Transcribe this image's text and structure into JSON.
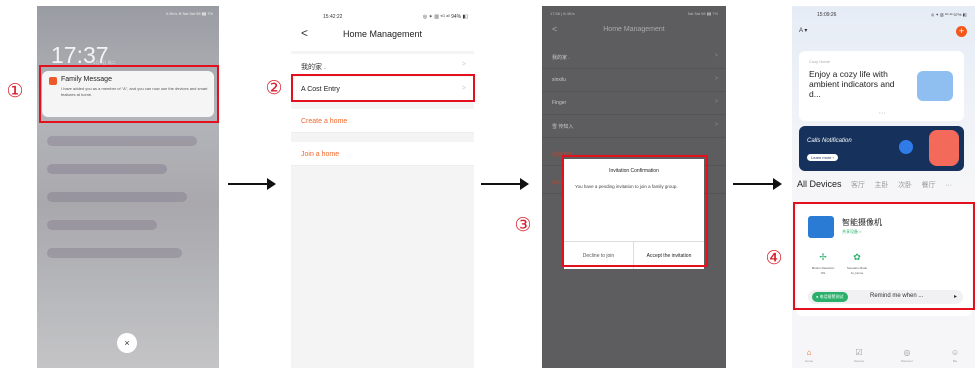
{
  "steps": [
    "①",
    "②",
    "③",
    "④"
  ],
  "screen1": {
    "status": "0.0K/s ≋ 5at 5at 98 ▮▮ 7%",
    "clock": "17:37",
    "clock_date": "4月 9日 周二",
    "notification": {
      "title": "Family Message",
      "body": "I have added you as a member of \"A\", and you can now use the devices and smart features at home."
    },
    "close_glyph": "×"
  },
  "screen2": {
    "time": "15:42:22",
    "status": "◎ ✶ ▥ ⁵ᴳ ᵃˡˡ 94% ▮▯",
    "back_glyph": "<",
    "title": "Home Management",
    "rows": [
      {
        "label": "我的家 .",
        "chevron": ">"
      },
      {
        "label": "A   Cost Entry",
        "chevron": ">"
      },
      {
        "label": "Create a home",
        "chevron": ""
      },
      {
        "label": "Join a home",
        "chevron": ""
      }
    ],
    "accent_color": "#f0682c"
  },
  "screen3": {
    "time": "17:56 | 8.4K/s",
    "status": "5at 5at 98 ▮▮ 7%",
    "back_glyph": "<",
    "title": "Home Management",
    "rows": [
      {
        "label": "我的家 .",
        "chevron": ">"
      },
      {
        "label": "xinxilu",
        "chevron": ">"
      },
      {
        "label": "Finger",
        "chevron": ">"
      },
      {
        "label": "雪 传知入",
        "chevron": ">"
      },
      {
        "label": "创建家庭",
        "chevron": ""
      },
      {
        "label": "加入",
        "chevron": ""
      }
    ],
    "dialog": {
      "title": "Invitation Confirmation",
      "body": "You have a pending invitation to join a family group.",
      "decline": "Decline to join",
      "accept": "Accept the invitation"
    }
  },
  "screen4": {
    "time": "15:09:26",
    "status": "◎ ✶ ▥ ⁵ᴳ ᵃˡˡ 97% ▮▯",
    "home_label": "A ▾",
    "plus_glyph": "+",
    "card1": {
      "small": "Cozy Home",
      "text": "Enjoy a cozy life with ambient indicators and d...",
      "dots": "• • •"
    },
    "card2": {
      "title": "Calls Notification",
      "button": "Learn more ›"
    },
    "tabs": [
      "All Devices",
      "客厅",
      "主卧",
      "次卧",
      "餐厅",
      "···"
    ],
    "device": {
      "name": "智能摄像机",
      "sub": "共享设备 >",
      "controls": [
        {
          "icon": "✢",
          "label": "Motion Detection",
          "value": "ON"
        },
        {
          "icon": "✿",
          "label": "Scenario Mode",
          "value": "At_Home"
        }
      ],
      "remind_button": "● 电话报警测试",
      "remind_text": "Remind me when ...",
      "remind_arrow": "▸"
    },
    "nav": [
      {
        "icon": "⌂",
        "label": "Home"
      },
      {
        "icon": "☑",
        "label": "Scenes"
      },
      {
        "icon": "◎",
        "label": "Discover"
      },
      {
        "icon": "☺",
        "label": "Me"
      }
    ]
  }
}
